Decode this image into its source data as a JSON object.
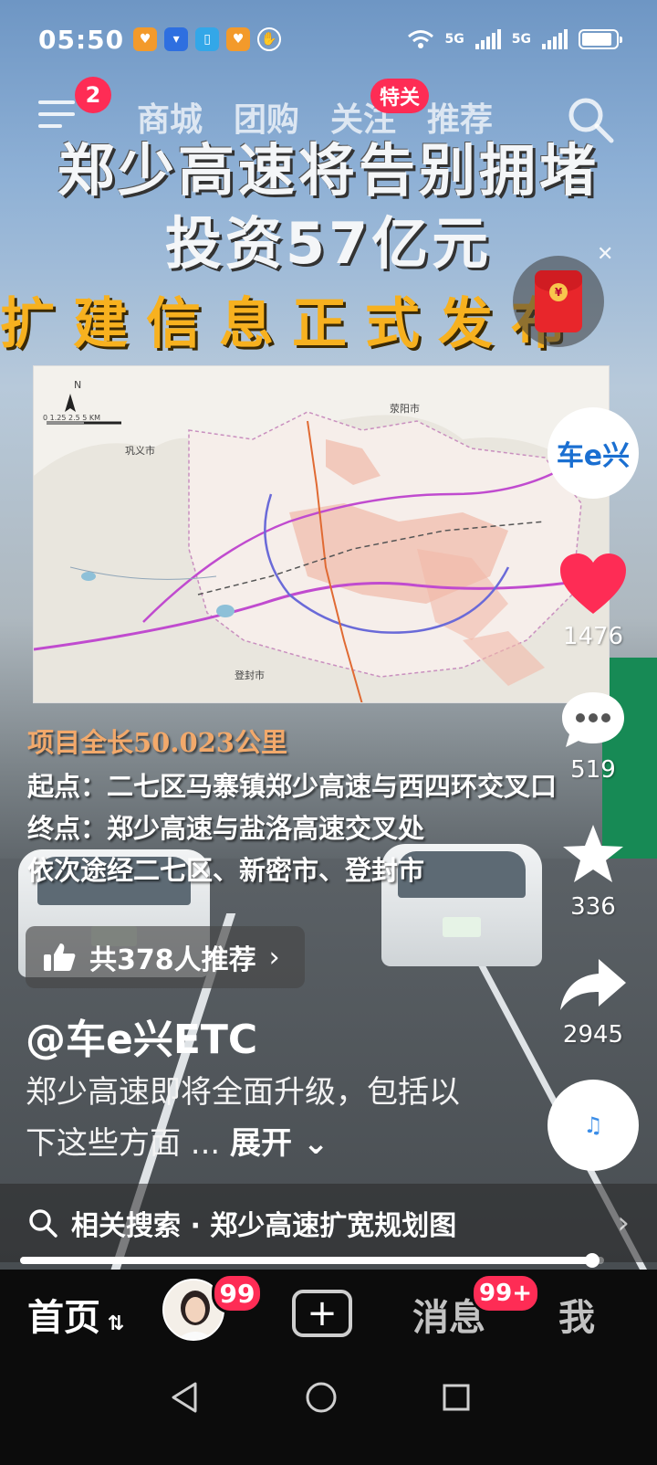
{
  "status_bar": {
    "time": "05:50",
    "network_1": "5G",
    "network_2": "5G",
    "battery_percent": 90
  },
  "top_nav": {
    "menu_badge": "2",
    "tabs": [
      {
        "label": "商城"
      },
      {
        "label": "团购"
      },
      {
        "label": "关注",
        "badge": "特关"
      },
      {
        "label": "推荐"
      }
    ]
  },
  "video": {
    "headline_1": "郑少高速将告别拥堵",
    "headline_2": "投资57亿元",
    "headline_3": "扩建信息正式发布",
    "map_labels": {
      "gongyi": "巩义市",
      "xingyang": "荥阳市",
      "dengfeng": "登封市",
      "north": "N",
      "scale": "0  1.25  2.5       5 KM"
    },
    "info_1": "项目全长50.023公里",
    "info_2": "起点：二七区马寨镇郑少高速与西四环交叉口",
    "info_3": "终点：郑少高速与盐洛高速交叉处",
    "info_4": "依次途经二七区、新密市、登封市"
  },
  "side_actions": {
    "account_avatar_text": "车e兴",
    "like_count": "1476",
    "comment_count": "519",
    "favorite_count": "336",
    "share_count": "2945"
  },
  "red_packet_coin": "¥",
  "recommend": {
    "label": "共378人推荐"
  },
  "author": "@车e兴ETC",
  "description": {
    "text": "郑少高速即将全面升级，包括以下这些方面 ...",
    "more": "展开"
  },
  "related_search": {
    "label": "相关搜索 · 郑少高速扩宽规划图"
  },
  "playback_progress": 0.98,
  "bottom_bar": {
    "home": "首页",
    "friends_badge": "99",
    "messages": "消息",
    "messages_badge": "99+",
    "me": "我"
  },
  "colors": {
    "accent": "#fe2c55",
    "headline_orange": "#f7b11f",
    "info_orange": "#f2a96b"
  }
}
